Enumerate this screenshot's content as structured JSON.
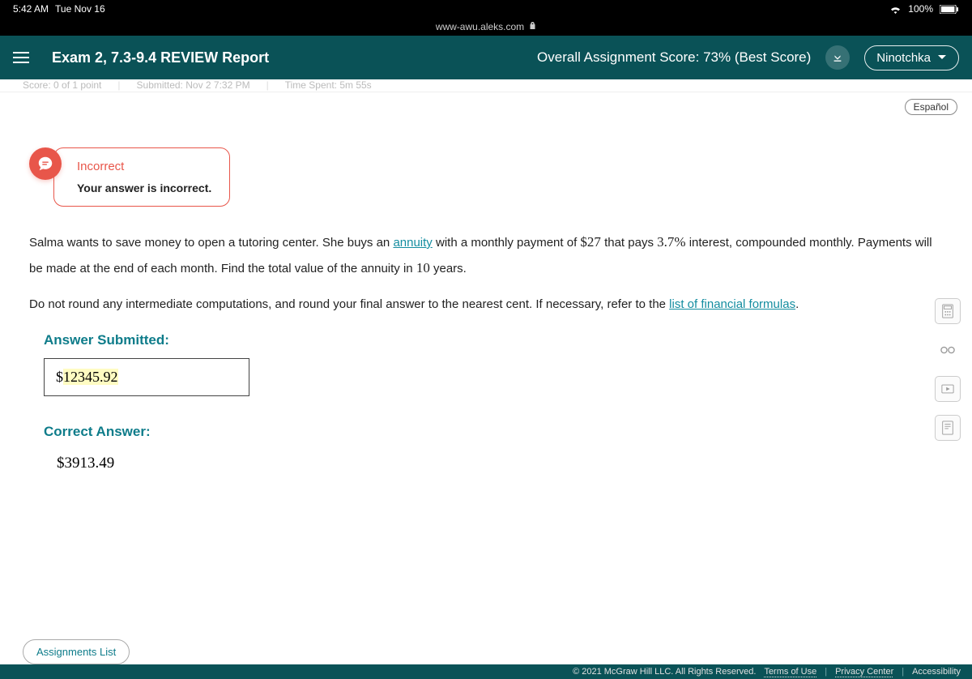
{
  "status_bar": {
    "time": "5:42 AM",
    "date": "Tue Nov 16",
    "battery": "100%"
  },
  "url_bar": {
    "host": "www-awu.aleks.com"
  },
  "header": {
    "title": "Exam 2, 7.3-9.4 REVIEW Report",
    "overall_score": "Overall Assignment Score: 73% (Best Score)",
    "user": "Ninotchka"
  },
  "submeta": {
    "score": "Score: 0 of 1 point",
    "submitted": "Submitted: Nov 2 7:32 PM",
    "time_spent": "Time Spent: 5m 55s"
  },
  "language_button": "Español",
  "feedback": {
    "title": "Incorrect",
    "message": "Your answer is incorrect."
  },
  "question": {
    "p1a": "Salma wants to save money to open a tutoring center. She buys an ",
    "link1": "annuity",
    "p1b": " with a monthly payment of ",
    "amount": "$27",
    "p1c": " that pays ",
    "rate": "3.7%",
    "p1d": " interest, compounded monthly. Payments will be made at the end of each month. Find the total value of the annuity in ",
    "years": "10",
    "p1e": " years.",
    "p2a": "Do not round any intermediate computations, and round your final answer to the nearest cent. If necessary, refer to the ",
    "link2": "list of financial formulas",
    "p2b": "."
  },
  "answer_submitted": {
    "label": "Answer Submitted:",
    "currency": "$",
    "value": "12345.92"
  },
  "correct_answer": {
    "label": "Correct Answer:",
    "value": "$3913.49"
  },
  "footer": {
    "assignments": "Assignments List",
    "copyright": "© 2021 McGraw Hill LLC. All Rights Reserved.",
    "terms": "Terms of Use",
    "privacy": "Privacy Center",
    "accessibility": "Accessibility"
  }
}
